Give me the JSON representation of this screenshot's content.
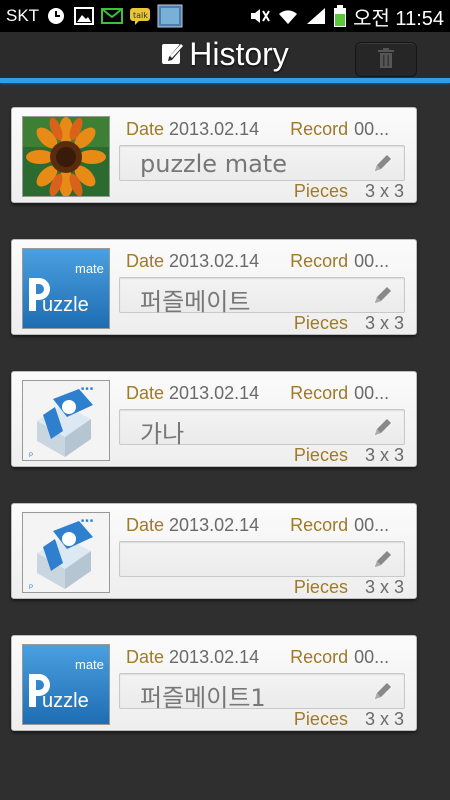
{
  "status_bar": {
    "carrier": "SKT",
    "time": "오전 11:54",
    "icons": [
      "clock-icon",
      "gallery-icon",
      "mail-icon",
      "chat-icon",
      "app-thumbnail-icon",
      "mute-icon",
      "wifi-icon",
      "signal-icon",
      "battery-icon"
    ]
  },
  "header": {
    "title": "History",
    "title_icon": "edit-note-icon",
    "delete_icon": "trash-icon"
  },
  "labels": {
    "date": "Date",
    "record": "Record",
    "pieces": "Pieces"
  },
  "colors": {
    "accent": "#2f9ee6",
    "label": "#a07a2a",
    "value": "#6a6a6a",
    "background": "#2f2f2f"
  },
  "items": [
    {
      "thumbnail": "sunflower-image",
      "date": "2013.02.14",
      "record": "00...",
      "name": "puzzle mate",
      "pieces": "3 x 3"
    },
    {
      "thumbnail": "puzzle-mate-logo-image",
      "date": "2013.02.14",
      "record": "00...",
      "name": "퍼즐메이트",
      "pieces": "3 x 3"
    },
    {
      "thumbnail": "cube-logo-image",
      "date": "2013.02.14",
      "record": "00...",
      "name": "가나",
      "pieces": "3 x 3"
    },
    {
      "thumbnail": "cube-logo-image",
      "date": "2013.02.14",
      "record": "00...",
      "name": "",
      "pieces": "3 x 3"
    },
    {
      "thumbnail": "puzzle-mate-logo-image",
      "date": "2013.02.14",
      "record": "00...",
      "name": "퍼즐메이트1",
      "pieces": "3 x 3"
    }
  ]
}
